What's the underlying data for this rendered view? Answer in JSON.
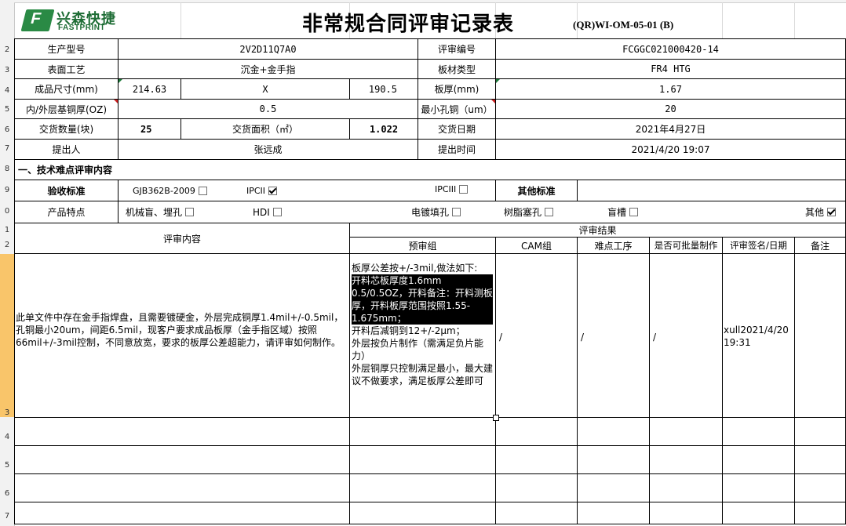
{
  "row_numbers": [
    "2",
    "3",
    "4",
    "5",
    "6",
    "7",
    "8",
    "9",
    "0",
    "1",
    "2",
    "3",
    "4",
    "5",
    "6",
    "7"
  ],
  "header": {
    "logo_cn": "兴森快捷",
    "logo_en": "FASTPRINT",
    "title": "非常规合同评审记录表",
    "form_code": "(QR)WI-OM-05-01 (B)"
  },
  "info": {
    "model_label": "生产型号",
    "model": "2V2D11Q7A0",
    "review_no_label": "评审编号",
    "review_no": "FCGGC021000420-14",
    "surface_label": "表面工艺",
    "surface": "沉金+金手指",
    "material_label": "板材类型",
    "material": "FR4 HTG",
    "size_label": "成品尺寸(mm)",
    "size_w": "214.63",
    "size_x": "X",
    "size_h": "190.5",
    "thickness_label": "板厚(mm)",
    "thickness": "1.67",
    "copper_label": "内/外层基铜厚(OZ)",
    "copper": "0.5",
    "min_hole_label": "最小孔铜（um）",
    "min_hole": "20",
    "qty_label": "交货数量(块)",
    "qty": "25",
    "area_label": "交货面积（㎡）",
    "area": "1.022",
    "delivery_label": "交货日期",
    "delivery": "2021年4月27日",
    "proposer_label": "提出人",
    "proposer": "张远成",
    "submit_time_label": "提出时间",
    "submit_time": "2021/4/20 19:07"
  },
  "section1": {
    "title": "一、技术难点评审内容",
    "acceptance_label": "验收标准",
    "std_gjb": "GJB362B-2009",
    "std_gjb_checked": false,
    "std_ipc2": "IPCII",
    "std_ipc2_checked": true,
    "std_ipc3": "IPCIII",
    "std_ipc3_checked": false,
    "other_std_label": "其他标准",
    "features_label": "产品特点",
    "feat_blind": "机械盲、埋孔",
    "feat_blind_checked": false,
    "feat_hdi": "HDI",
    "feat_hdi_checked": false,
    "feat_plating": "电镀填孔",
    "feat_plating_checked": false,
    "feat_resin": "树脂塞孔",
    "feat_resin_checked": false,
    "feat_slot": "盲槽",
    "feat_slot_checked": false,
    "feat_other": "其他",
    "feat_other_checked": true
  },
  "review": {
    "content_header": "评审内容",
    "result_header": "评审结果",
    "col_pre": "预审组",
    "col_cam": "CAM组",
    "col_difficult": "难点工序",
    "col_batch": "是否可批量制作",
    "col_sign": "评审签名/日期",
    "col_remark": "备注",
    "content_text": "此单文件中存在金手指焊盘，且需要镀硬金，外层完成铜厚1.4mil+/-0.5mil，孔铜最小20um，间距6.5mil，现客户要求成品板厚（金手指区域）按照66mil+/-3mil控制，不同意放宽，要求的板厚公差超能力，请评审如何制作。",
    "pre_line1": "板厚公差按+/-3mil,做法如下:",
    "pre_hl": "开料芯板厚度1.6mm 0.5/0.5OZ，开料备注：开料测板厚，开料板厚范围按照1.55-1.675mm；",
    "pre_line3": "开料后减铜到12+/-2μm；",
    "pre_line4": "外层按负片制作（需满足负片能力）",
    "pre_line5": "外层铜厚只控制满足最小，最大建议不做要求，满足板厚公差即可",
    "cam_value": "/",
    "difficult_value": "/",
    "batch_value": "/",
    "sign_value": "xull2021/4/20 19:31"
  }
}
